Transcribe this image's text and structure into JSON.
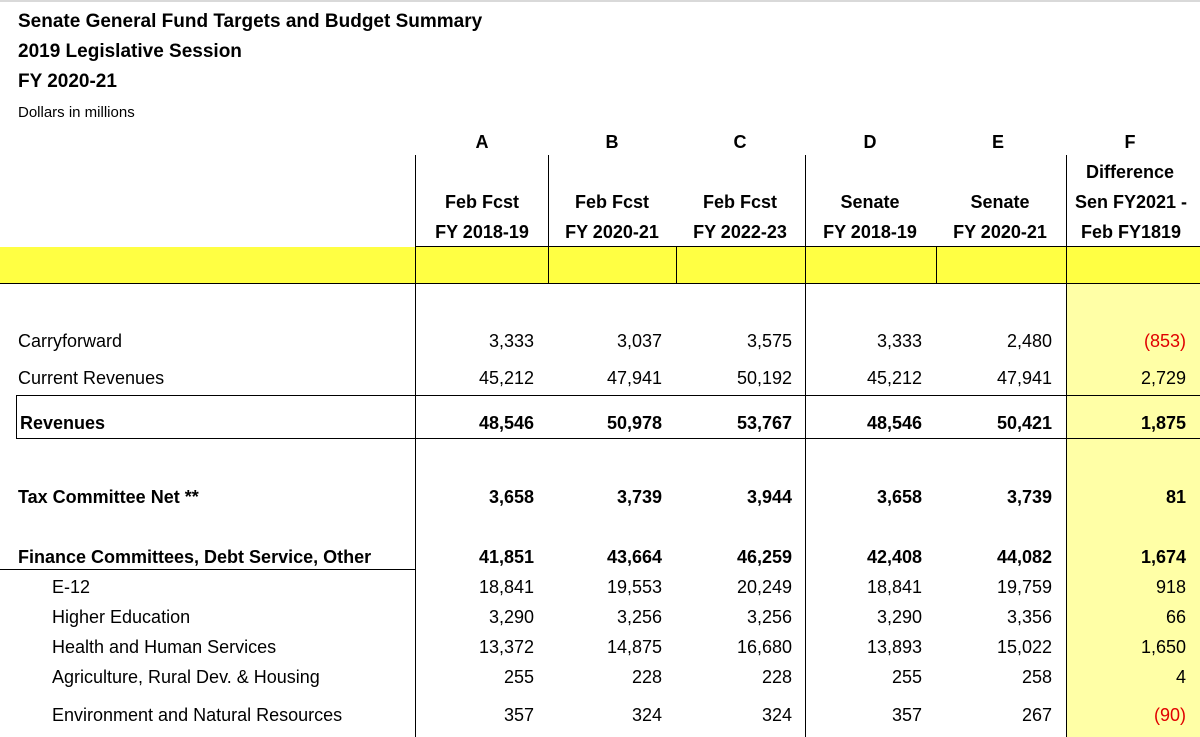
{
  "header": {
    "title_line1": "Senate General Fund Targets and Budget Summary",
    "title_line2": "2019 Legislative Session",
    "title_line3": "FY 2020-21",
    "subtitle": "Dollars in millions"
  },
  "columns": [
    {
      "letter": "A",
      "line1": "",
      "line2": "Feb Fcst",
      "line3": "FY 2018-19"
    },
    {
      "letter": "B",
      "line1": "",
      "line2": "Feb Fcst",
      "line3": "FY 2020-21"
    },
    {
      "letter": "C",
      "line1": "",
      "line2": "Feb Fcst",
      "line3": "FY 2022-23"
    },
    {
      "letter": "D",
      "line1": "",
      "line2": "Senate",
      "line3": "FY 2018-19"
    },
    {
      "letter": "E",
      "line1": "",
      "line2": "Senate",
      "line3": "FY 2020-21"
    },
    {
      "letter": "F",
      "line1": "Difference",
      "line2": "Sen FY2021 -",
      "line3": "Feb FY1819"
    }
  ],
  "rows": [
    {
      "label": "Carryforward",
      "values": [
        "3,333",
        "3,037",
        "3,575",
        "3,333",
        "2,480",
        "(853)"
      ]
    },
    {
      "label": "Current Revenues",
      "values": [
        "45,212",
        "47,941",
        "50,192",
        "45,212",
        "47,941",
        "2,729"
      ]
    },
    {
      "label": "Revenues",
      "values": [
        "48,546",
        "50,978",
        "53,767",
        "48,546",
        "50,421",
        "1,875"
      ]
    },
    {
      "label": "Tax Committee Net **",
      "values": [
        "3,658",
        "3,739",
        "3,944",
        "3,658",
        "3,739",
        "81"
      ]
    },
    {
      "label": "Finance Committees, Debt Service, Other",
      "values": [
        "41,851",
        "43,664",
        "46,259",
        "42,408",
        "44,082",
        "1,674"
      ]
    },
    {
      "label": "E-12",
      "values": [
        "18,841",
        "19,553",
        "20,249",
        "18,841",
        "19,759",
        "918"
      ]
    },
    {
      "label": "Higher Education",
      "values": [
        "3,290",
        "3,256",
        "3,256",
        "3,290",
        "3,356",
        "66"
      ]
    },
    {
      "label": "Health and Human Services",
      "values": [
        "13,372",
        "14,875",
        "16,680",
        "13,893",
        "15,022",
        "1,650"
      ]
    },
    {
      "label": "Agriculture, Rural Dev. & Housing",
      "values": [
        "255",
        "228",
        "228",
        "255",
        "258",
        "4"
      ]
    },
    {
      "label": "Environment and Natural Resources",
      "values": [
        "357",
        "324",
        "324",
        "357",
        "267",
        "(90)"
      ]
    }
  ],
  "colors": {
    "negative": "#e00000",
    "highlight_band": "#ffff43",
    "highlight_col": "#ffffa6"
  }
}
